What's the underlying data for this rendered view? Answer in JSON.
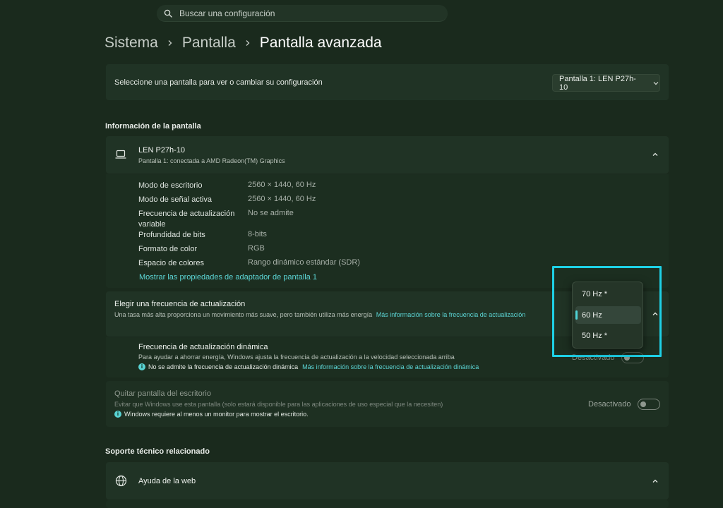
{
  "search": {
    "placeholder": "Buscar una configuración"
  },
  "breadcrumb": {
    "level1": "Sistema",
    "level2": "Pantalla",
    "current": "Pantalla avanzada"
  },
  "select_display": {
    "label": "Seleccione una pantalla para ver o cambiar su configuración",
    "value": "Pantalla 1: LEN P27h-10"
  },
  "display_info": {
    "section_title": "Información de la pantalla",
    "monitor_name": "LEN P27h-10",
    "monitor_sub": "Pantalla 1: conectada a AMD Radeon(TM) Graphics",
    "rows": [
      {
        "label": "Modo de escritorio",
        "value": "2560 × 1440, 60 Hz"
      },
      {
        "label": "Modo de señal activa",
        "value": "2560 × 1440, 60 Hz"
      },
      {
        "label": "Frecuencia de actualización variable",
        "value": "No se admite"
      },
      {
        "label": "Profundidad de bits",
        "value": "8-bits"
      },
      {
        "label": "Formato de color",
        "value": "RGB"
      },
      {
        "label": "Espacio de colores",
        "value": "Rango dinámico estándar (SDR)"
      }
    ],
    "adapter_link": "Mostrar las propiedades de adaptador de pantalla 1"
  },
  "refresh_rate": {
    "title": "Elegir una frecuencia de actualización",
    "desc": "Una tasa más alta proporciona un movimiento más suave, pero también utiliza más energía",
    "link": "Más información sobre la frecuencia de actualización",
    "options": [
      "70 Hz *",
      "60 Hz",
      "50 Hz *"
    ],
    "selected": "60 Hz"
  },
  "dynamic_refresh": {
    "title": "Frecuencia de actualización dinámica",
    "desc": "Para ayudar a ahorrar energía, Windows ajusta la frecuencia de actualización a la velocidad seleccionada arriba",
    "info": "No se admite la frecuencia de actualización dinámica",
    "link": "Más información sobre la frecuencia de actualización dinámica",
    "state": "Desactivado"
  },
  "remove_display": {
    "title": "Quitar pantalla del escritorio",
    "desc": "Evitar que Windows use esta pantalla (solo estará disponible para las aplicaciones de uso especial que la necesiten)",
    "info": "Windows requiere al menos un monitor para mostrar el escritorio.",
    "state": "Desactivado"
  },
  "support": {
    "section_title": "Soporte técnico relacionado",
    "web_help": "Ayuda de la web"
  },
  "colors": {
    "background": "#1a2a1d",
    "card": "#203325",
    "accent": "#5cd6d6",
    "highlight": "#1ed1e6"
  }
}
